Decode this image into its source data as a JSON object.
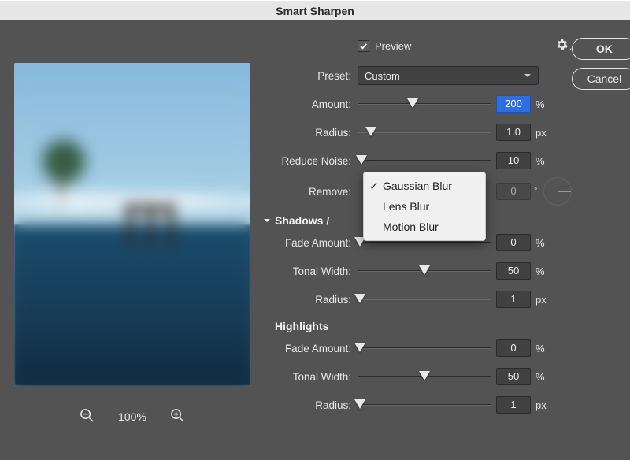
{
  "title": "Smart Sharpen",
  "preview_label": "Preview",
  "preview_checked": true,
  "preset_label": "Preset:",
  "preset_value": "Custom",
  "buttons": {
    "ok": "OK",
    "cancel": "Cancel"
  },
  "sliders": {
    "amount": {
      "label": "Amount:",
      "value": "200",
      "unit": "%",
      "pos": 41
    },
    "radius": {
      "label": "Radius:",
      "value": "1.0",
      "unit": "px",
      "pos": 10
    },
    "reduceNoise": {
      "label": "Reduce Noise:",
      "value": "10",
      "unit": "%",
      "pos": 3
    }
  },
  "remove": {
    "label": "Remove:",
    "selected": "Gaussian Blur",
    "options": [
      "Gaussian Blur",
      "Lens Blur",
      "Motion Blur"
    ],
    "angle_value": "0"
  },
  "sections": {
    "shadows": "Shadows /",
    "highlights": "Highlights"
  },
  "shadows": {
    "fade": {
      "label": "Fade Amount:",
      "value": "0",
      "unit": "%",
      "pos": 2
    },
    "tonal": {
      "label": "Tonal Width:",
      "value": "50",
      "unit": "%",
      "pos": 50
    },
    "radius": {
      "label": "Radius:",
      "value": "1",
      "unit": "px",
      "pos": 2
    }
  },
  "highlights": {
    "fade": {
      "label": "Fade Amount:",
      "value": "0",
      "unit": "%",
      "pos": 2
    },
    "tonal": {
      "label": "Tonal Width:",
      "value": "50",
      "unit": "%",
      "pos": 50
    },
    "radius": {
      "label": "Radius:",
      "value": "1",
      "unit": "px",
      "pos": 2
    }
  },
  "zoom": "100%"
}
